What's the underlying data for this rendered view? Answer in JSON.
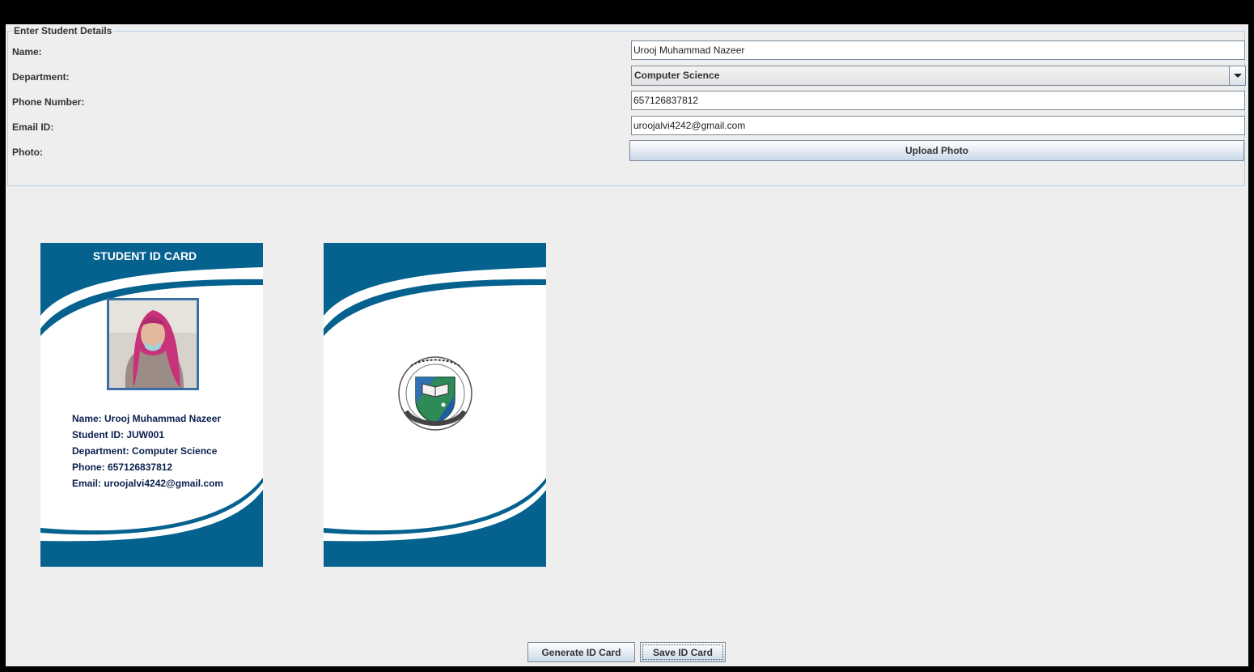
{
  "form": {
    "legend": "Enter Student Details",
    "name_label": "Name:",
    "name_value": "Urooj Muhammad Nazeer",
    "department_label": "Department:",
    "department_value": "Computer Science",
    "phone_label": "Phone Number:",
    "phone_value": "657126837812",
    "email_label": "Email ID:",
    "email_value": "uroojalvi4242@gmail.com",
    "photo_label": "Photo:",
    "upload_button": "Upload Photo"
  },
  "card_front": {
    "title": "STUDENT ID CARD",
    "rows": [
      "Name: Urooj Muhammad Nazeer",
      "Student ID: JUW001",
      "Department: Computer Science",
      "Phone: 657126837812",
      "Email: uroojalvi4242@gmail.com"
    ]
  },
  "buttons": {
    "generate": "Generate ID Card",
    "save": "Save ID Card"
  },
  "colors": {
    "card_blue": "#05628f",
    "border_light": "#b8cfe5"
  }
}
